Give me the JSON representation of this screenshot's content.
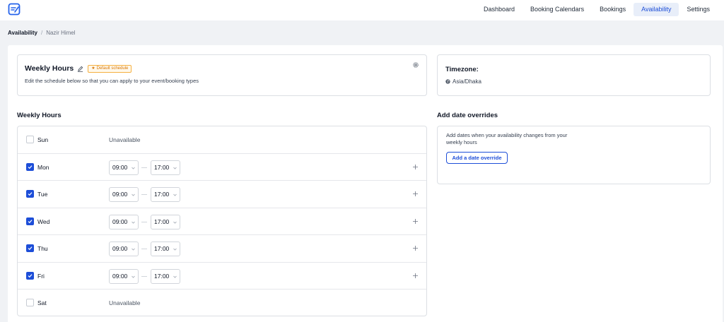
{
  "nav": {
    "items": [
      {
        "label": "Dashboard",
        "active": false
      },
      {
        "label": "Booking Calendars",
        "active": false
      },
      {
        "label": "Bookings",
        "active": false
      },
      {
        "label": "Availability",
        "active": true
      },
      {
        "label": "Settings",
        "active": false
      }
    ]
  },
  "breadcrumb": {
    "root": "Availability",
    "separator": "/",
    "current": "Nazir Himel"
  },
  "schedule": {
    "title": "Weekly Hours",
    "badge": "Default schedule",
    "description": "Edit the schedule below so that you can apply to your event/booking types"
  },
  "timezone": {
    "title": "Timezone:",
    "value": "Asia/Dhaka"
  },
  "weekly_hours": {
    "title": "Weekly Hours",
    "unavailable_text": "Unavailable",
    "days": [
      {
        "label": "Sun",
        "checked": false,
        "start": "",
        "end": ""
      },
      {
        "label": "Mon",
        "checked": true,
        "start": "09:00",
        "end": "17:00"
      },
      {
        "label": "Tue",
        "checked": true,
        "start": "09:00",
        "end": "17:00"
      },
      {
        "label": "Wed",
        "checked": true,
        "start": "09:00",
        "end": "17:00"
      },
      {
        "label": "Thu",
        "checked": true,
        "start": "09:00",
        "end": "17:00"
      },
      {
        "label": "Fri",
        "checked": true,
        "start": "09:00",
        "end": "17:00"
      },
      {
        "label": "Sat",
        "checked": false,
        "start": "",
        "end": ""
      }
    ]
  },
  "overrides": {
    "title": "Add date overrides",
    "description": "Add dates when your availability changes from your weekly hours",
    "button": "Add a date override"
  },
  "colors": {
    "accent": "#1d4ed8",
    "badge": "#d97706",
    "background": "#f0f2f5"
  }
}
